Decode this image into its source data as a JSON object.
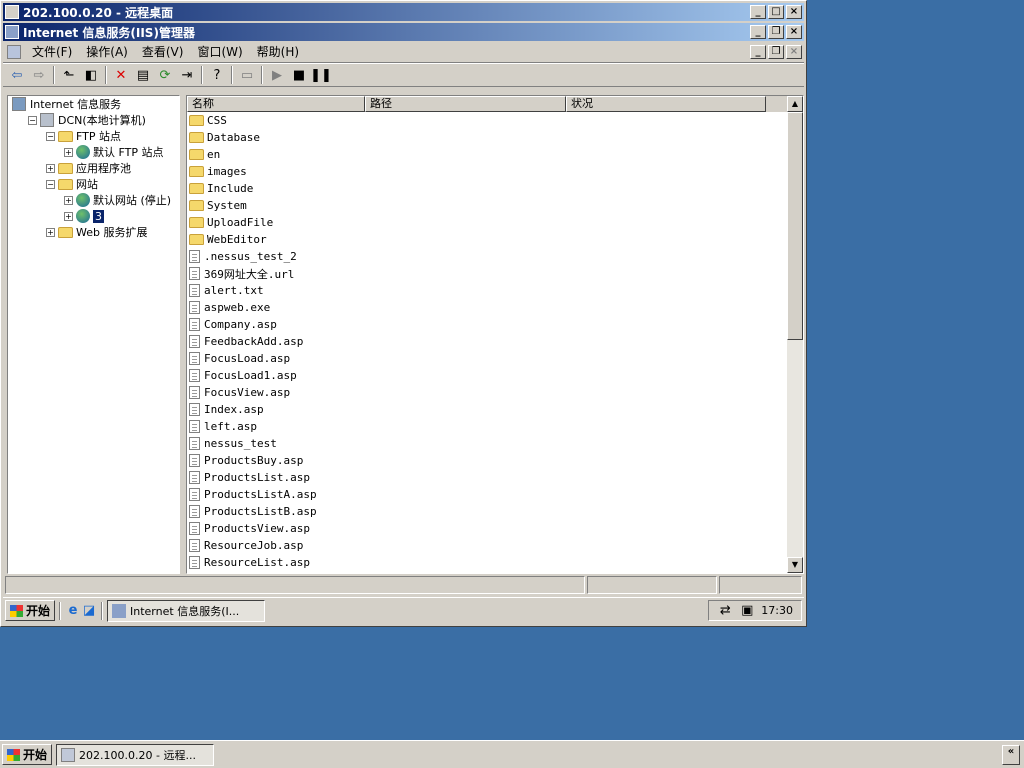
{
  "rdp": {
    "title": "202.100.0.20 - 远程桌面"
  },
  "mmc": {
    "title": "Internet 信息服务(IIS)管理器"
  },
  "menu": [
    "文件(F)",
    "操作(A)",
    "查看(V)",
    "窗口(W)",
    "帮助(H)"
  ],
  "tree": [
    {
      "label": "Internet 信息服务",
      "level": 0,
      "expander": "",
      "icon": "iis-icon"
    },
    {
      "label": "DCN(本地计算机)",
      "level": 1,
      "expander": "−",
      "icon": "computer-icon"
    },
    {
      "label": "FTP 站点",
      "level": 2,
      "expander": "−",
      "icon": "folder-icon"
    },
    {
      "label": "默认 FTP 站点",
      "level": 3,
      "expander": "+",
      "icon": "globe-icon"
    },
    {
      "label": "应用程序池",
      "level": 2,
      "expander": "+",
      "icon": "folder-icon"
    },
    {
      "label": "网站",
      "level": 2,
      "expander": "−",
      "icon": "folder-icon"
    },
    {
      "label": "默认网站 (停止)",
      "level": 3,
      "expander": "+",
      "icon": "globe-icon"
    },
    {
      "label": "3",
      "level": 3,
      "expander": "+",
      "icon": "globe-icon",
      "selected": true
    },
    {
      "label": "Web 服务扩展",
      "level": 2,
      "expander": "+",
      "icon": "folder-icon"
    }
  ],
  "list": {
    "columns": [
      "名称",
      "路径",
      "状况"
    ],
    "rows": [
      {
        "name": "CSS",
        "type": "folder"
      },
      {
        "name": "Database",
        "type": "folder"
      },
      {
        "name": "en",
        "type": "folder"
      },
      {
        "name": "images",
        "type": "folder"
      },
      {
        "name": "Include",
        "type": "folder"
      },
      {
        "name": "System",
        "type": "folder"
      },
      {
        "name": "UploadFile",
        "type": "folder"
      },
      {
        "name": "WebEditor",
        "type": "folder"
      },
      {
        "name": ".nessus_test_2",
        "type": "file"
      },
      {
        "name": "369网址大全.url",
        "type": "file"
      },
      {
        "name": "alert.txt",
        "type": "file"
      },
      {
        "name": "aspweb.exe",
        "type": "file"
      },
      {
        "name": "Company.asp",
        "type": "file"
      },
      {
        "name": "FeedbackAdd.asp",
        "type": "file"
      },
      {
        "name": "FocusLoad.asp",
        "type": "file"
      },
      {
        "name": "FocusLoad1.asp",
        "type": "file"
      },
      {
        "name": "FocusView.asp",
        "type": "file"
      },
      {
        "name": "Index.asp",
        "type": "file"
      },
      {
        "name": "left.asp",
        "type": "file"
      },
      {
        "name": "nessus_test",
        "type": "file"
      },
      {
        "name": "ProductsBuy.asp",
        "type": "file"
      },
      {
        "name": "ProductsList.asp",
        "type": "file"
      },
      {
        "name": "ProductsListA.asp",
        "type": "file"
      },
      {
        "name": "ProductsListB.asp",
        "type": "file"
      },
      {
        "name": "ProductsView.asp",
        "type": "file"
      },
      {
        "name": "ResourceJob.asp",
        "type": "file"
      },
      {
        "name": "ResourceList.asp",
        "type": "file"
      }
    ]
  },
  "inner_taskbar": {
    "start": "开始",
    "task": "Internet 信息服务(I...",
    "clock": "17:30"
  },
  "outer_taskbar": {
    "start": "开始",
    "task": "202.100.0.20 - 远程..."
  }
}
